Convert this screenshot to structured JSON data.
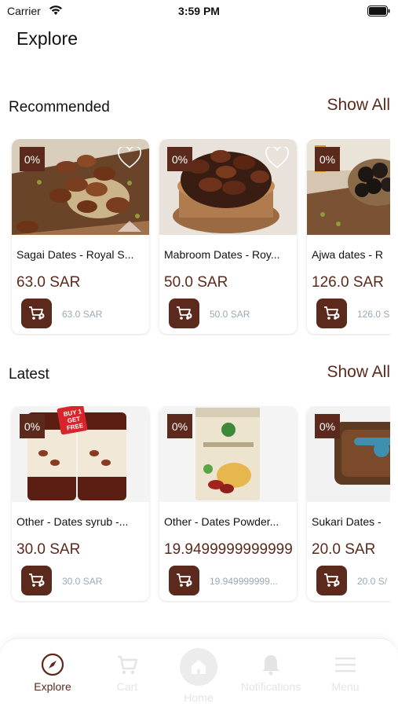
{
  "status_bar": {
    "carrier": "Carrier",
    "time": "3:59 PM"
  },
  "page": {
    "title": "Explore"
  },
  "recommended": {
    "title": "Recommended",
    "show_all": "Show All",
    "products": [
      {
        "name": "Sagai Dates - Royal S...",
        "price": "63.0 SAR",
        "old_price": "63.0 SAR",
        "discount": "0%"
      },
      {
        "name": "Mabroom Dates - Roy...",
        "price": "50.0 SAR",
        "old_price": "50.0 SAR",
        "discount": "0%"
      },
      {
        "name": "Ajwa dates - R",
        "price": "126.0 SAR",
        "old_price": "126.0 S",
        "discount": "0%"
      }
    ]
  },
  "latest": {
    "title": "Latest",
    "show_all": "Show All",
    "products": [
      {
        "name": "Other - Dates syrub -...",
        "price": "30.0 SAR",
        "old_price": "30.0 SAR",
        "discount": "0%",
        "badge_text": "BUY 1 GET FREE"
      },
      {
        "name": "Other - Dates Powder...",
        "price": "19.9499999999999",
        "old_price": "19.949999999...",
        "discount": "0%"
      },
      {
        "name": "Sukari Dates -",
        "price": "20.0 SAR",
        "old_price": "20.0 S/",
        "discount": "0%"
      }
    ]
  },
  "tab_bar": {
    "explore": "Explore",
    "cart": "Cart",
    "home": "Home",
    "notifications": "Notifications",
    "menu": "Menu"
  },
  "colors": {
    "accent": "#5b2a1c",
    "inactive": "#e4e4e4",
    "old_price": "#9aa8b4"
  }
}
